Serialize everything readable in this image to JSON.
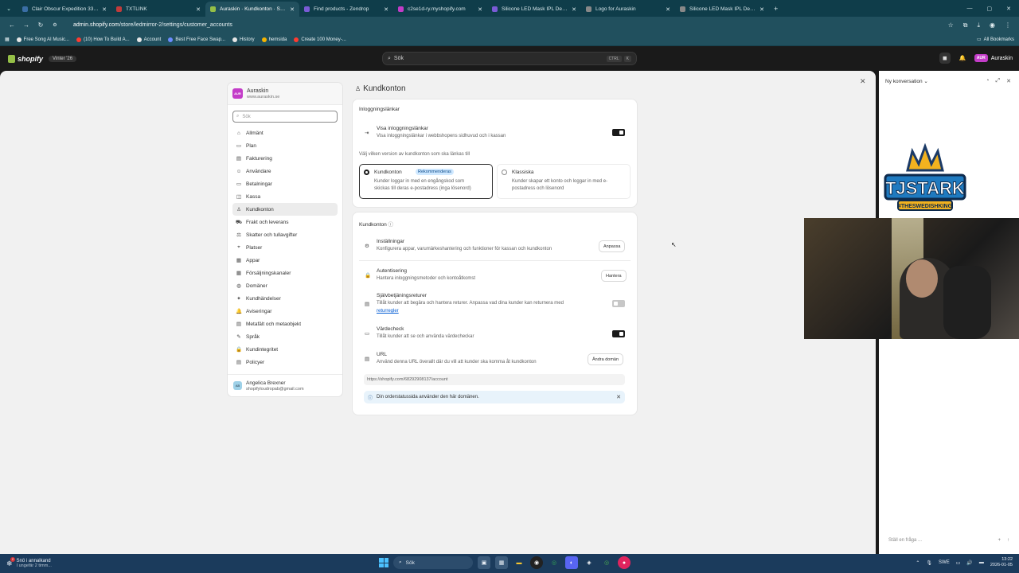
{
  "browser": {
    "tabs": [
      {
        "label": "Clair Obscur Expedition 33 – De",
        "color": "#3a6ea5",
        "active": false
      },
      {
        "label": "TXTLINK",
        "color": "#c23b3b",
        "active": false
      },
      {
        "label": "Auraskin · Kundkonton · Shopify",
        "color": "#95bf47",
        "active": true
      },
      {
        "label": "Find products - Zendrop",
        "color": "#7a5bd6",
        "active": false
      },
      {
        "label": "c2se1d-ry.myshopify.com",
        "color": "#c33cc8",
        "active": false
      },
      {
        "label": "Silicone LED Mask IPL Device fo",
        "color": "#7a5bd6",
        "active": false
      },
      {
        "label": "Logo for Auraskin",
        "color": "#888888",
        "active": false
      },
      {
        "label": "Silicone LED Mask IPL Device fo",
        "color": "#888888",
        "active": false
      }
    ],
    "new_tab": "+",
    "url_host": "admin.shopify.com",
    "url_path": "/store/ledmirror-2/settings/customer_accounts",
    "bookmarks": [
      {
        "label": "Free Song AI Music...",
        "color": "#e6e6e6"
      },
      {
        "label": "(10) How To Build A...",
        "color": "#ff3b30"
      },
      {
        "label": "Account",
        "color": "#e6e6e6"
      },
      {
        "label": "Best Free Face Swap...",
        "color": "#6b8cff"
      },
      {
        "label": "History",
        "color": "#e6e6e6"
      },
      {
        "label": "hemsida",
        "color": "#f4b400"
      },
      {
        "label": "Create 100 Money-...",
        "color": "#ff3b30"
      }
    ],
    "all_bookmarks": "All Bookmarks"
  },
  "shopify": {
    "logo": "shopify",
    "edition": "Vinter '26",
    "search_placeholder": "Sök",
    "kbd1": "CTRL",
    "kbd2": "K",
    "store_short": "AUR",
    "store_name_header": "Auraskin"
  },
  "sidebar": {
    "store_name": "Auraskin",
    "store_url": "www.auraskin.se",
    "search_placeholder": "Sök",
    "items": [
      {
        "label": "Allmänt",
        "icon": "⌂"
      },
      {
        "label": "Plan",
        "icon": "▭"
      },
      {
        "label": "Fakturering",
        "icon": "▤"
      },
      {
        "label": "Användare",
        "icon": "☺"
      },
      {
        "label": "Betalningar",
        "icon": "▭"
      },
      {
        "label": "Kassa",
        "icon": "◫"
      },
      {
        "label": "Kundkonton",
        "icon": "♙"
      },
      {
        "label": "Frakt och leverans",
        "icon": "⛟"
      },
      {
        "label": "Skatter och tullavgifter",
        "icon": "⚖"
      },
      {
        "label": "Platser",
        "icon": "⌖"
      },
      {
        "label": "Appar",
        "icon": "▦"
      },
      {
        "label": "Försäljningskanaler",
        "icon": "▦"
      },
      {
        "label": "Domäner",
        "icon": "◍"
      },
      {
        "label": "Kundhändelser",
        "icon": "✦"
      },
      {
        "label": "Aviseringar",
        "icon": "🔔"
      },
      {
        "label": "Metafält och metaobjekt",
        "icon": "▤"
      },
      {
        "label": "Språk",
        "icon": "✎"
      },
      {
        "label": "Kundintegritet",
        "icon": "🔒"
      },
      {
        "label": "Policyer",
        "icon": "▤"
      }
    ],
    "active_index": 6,
    "user_initials": "AB",
    "user_name": "Angelica Brexner",
    "user_email": "shopifyloudropab@gmail.com"
  },
  "page": {
    "title": "Kundkonton",
    "login_card": {
      "title": "Inloggningslänkar",
      "show_title": "Visa inloggningslänkar",
      "show_sub": "Visa inloggningslänkar i webbshopens sidhuvud och i kassan",
      "show_on": true,
      "choose_label": "Välj vilken version av kundkonton som ska länkas till",
      "opt1_title": "Kundkonton",
      "opt1_badge": "Rekommenderas",
      "opt1_sub1": "Kunder loggar in med en engångskod som",
      "opt1_sub2": "skickas till deras e-postadress (inga lösenord)",
      "opt2_title": "Klassiska",
      "opt2_sub1": "Kunder skapar ett konto och loggar in med e-",
      "opt2_sub2": "postadress och lösenord"
    },
    "accounts_card": {
      "title": "Kundkonton",
      "settings_title": "Inställningar",
      "settings_sub": "Konfigurera appar, varumärkeshantering och funktioner för kassan och kundkonton",
      "settings_btn": "Anpassa",
      "auth_title": "Autentisering",
      "auth_sub": "Hantera inloggningsmetoder och kontoåtkomst",
      "auth_btn": "Hantera",
      "returns_title": "Självbetjäningsreturer",
      "returns_sub": "Tillåt kunder att begära och hantera returer. Anpassa vad dina kunder kan returnera med",
      "returns_link": "returregler",
      "returns_on": false,
      "gift_title": "Värdecheck",
      "gift_sub": "Tillåt kunder att se och använda värdecheckar",
      "gift_on": true,
      "url_title": "URL",
      "url_sub": "Använd denna URL överallt där du vill att kunder ska komma åt kundkonton",
      "url_btn": "Ändra domän",
      "url_value": "https://shopify.com/68292908137/account",
      "banner": "Din orderstatussida använder den här domänen."
    }
  },
  "chat": {
    "title": "Ny konversation",
    "input_placeholder": "Ställ en fråga ..."
  },
  "overlay": {
    "logo_line1": "TJSTARK",
    "logo_line2": "#THESWEDISHKING"
  },
  "taskbar": {
    "weather_line1": "Snö i annalkand",
    "weather_line2": "I ungefär 2 timm...",
    "weather_badge": "2",
    "search": "Sök",
    "lang": "SWE",
    "time": "13:22",
    "date": "2026-01-05"
  }
}
